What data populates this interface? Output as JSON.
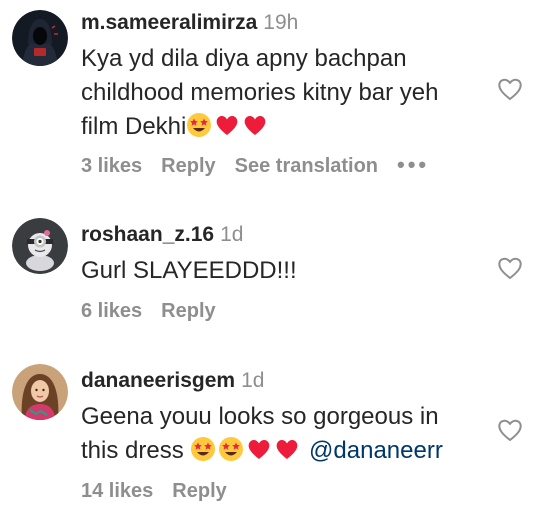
{
  "comments": [
    {
      "username": "m.sameeralimirza",
      "time": "19h",
      "lines": [
        "Kya yd dila diya apny bachpan",
        "childhood memories kitny bar yeh",
        "film Dekhi"
      ],
      "likes": "3 likes",
      "reply": "Reply",
      "translate": "See translation",
      "more": "•••",
      "avatar_icon": "hooded-figure-avatar",
      "emojis": [
        "star-struck-emoji",
        "red-heart-emoji",
        "red-heart-emoji"
      ]
    },
    {
      "username": "roshaan_z.16",
      "time": "1d",
      "lines": [
        "Gurl SLAYEEDDD!!!"
      ],
      "likes": "6 likes",
      "reply": "Reply",
      "avatar_icon": "minion-avatar"
    },
    {
      "username": "dananeerisgem",
      "time": "1d",
      "lines": [
        "Geena youu looks so gorgeous in",
        "this dress"
      ],
      "mention": "@dananeerr",
      "likes": "14 likes",
      "reply": "Reply",
      "avatar_icon": "profile-photo-avatar",
      "emojis": [
        "star-struck-emoji",
        "star-struck-emoji",
        "red-heart-emoji",
        "red-heart-emoji"
      ]
    }
  ],
  "colors": {
    "text": "#262626",
    "secondary": "#8e8e8e",
    "mention": "#00376b",
    "heart_red": "#ed1c3a",
    "emoji_yellow": "#ffc83d"
  },
  "icons": {
    "like": "heart-outline-icon"
  }
}
